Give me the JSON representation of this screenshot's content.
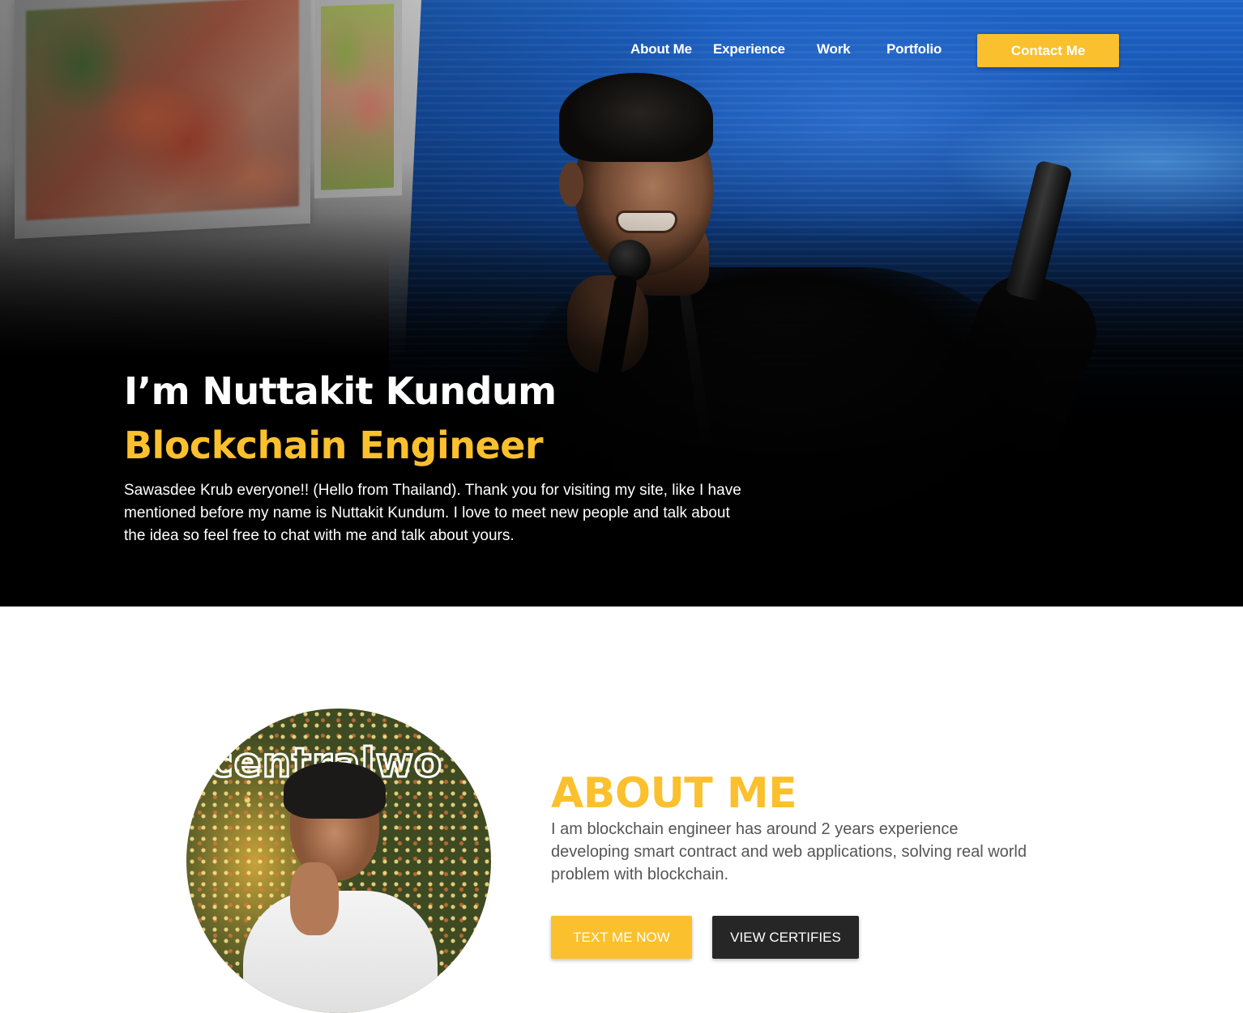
{
  "nav": {
    "links": [
      {
        "label": "About Me"
      },
      {
        "label": "Experience"
      },
      {
        "label": "Work"
      },
      {
        "label": "Portfolio"
      }
    ],
    "contact_label": "Contact Me"
  },
  "hero": {
    "title": "I’m Nuttakit Kundum",
    "subtitle": "Blockchain Engineer",
    "text": "Sawasdee Krub everyone!! (Hello from Thailand). Thank you for visiting my site, like I have mentioned before my name is Nuttakit Kundum. I love to meet new people and talk about the idea so feel free to chat with me and talk about yours."
  },
  "about": {
    "photo_sign": "centralwo",
    "heading": "ABOUT ME",
    "text": "I am blockchain engineer has around 2 years experience developing smart contract and web applications, solving real world problem with blockchain.",
    "primary_button": "TEXT ME NOW",
    "secondary_button": "VIEW CERTIFIES"
  },
  "colors": {
    "accent": "#fbc02d",
    "dark_button": "#262626",
    "body_text": "#555555"
  }
}
